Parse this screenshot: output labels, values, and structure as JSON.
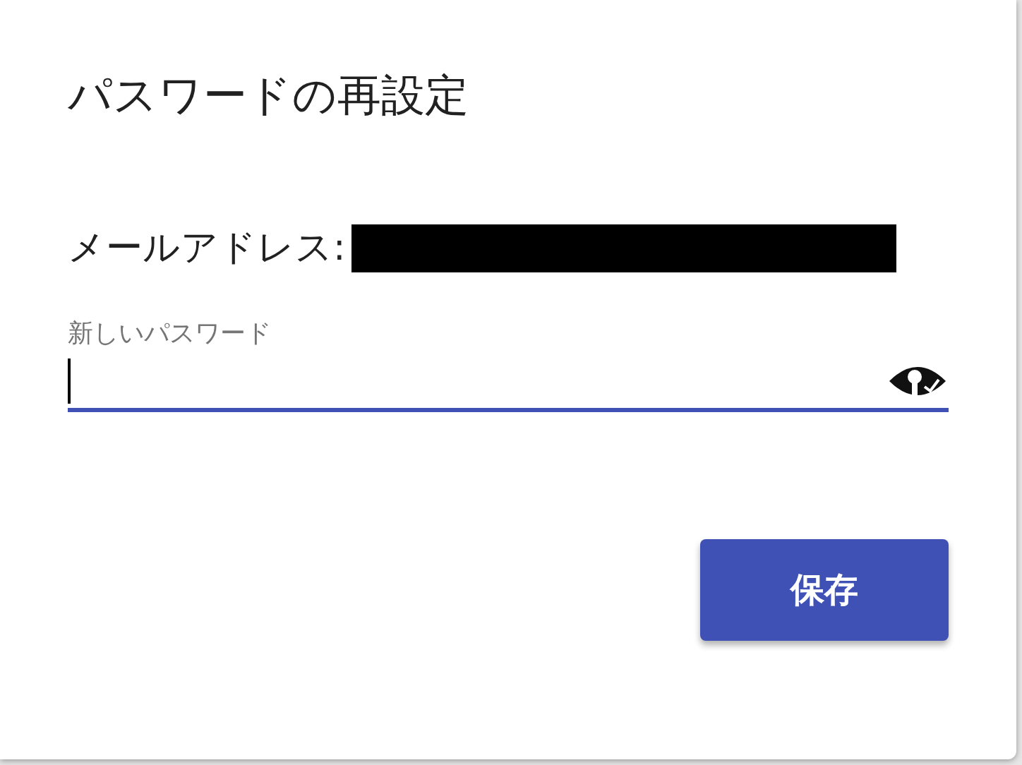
{
  "dialog": {
    "title": "パスワードの再設定",
    "email": {
      "label": "メールアドレス:",
      "redacted": true
    },
    "password_field": {
      "label": "新しいパスワード",
      "focused": true
    },
    "buttons": [
      {
        "label": "保存",
        "kind": "primary"
      }
    ]
  }
}
